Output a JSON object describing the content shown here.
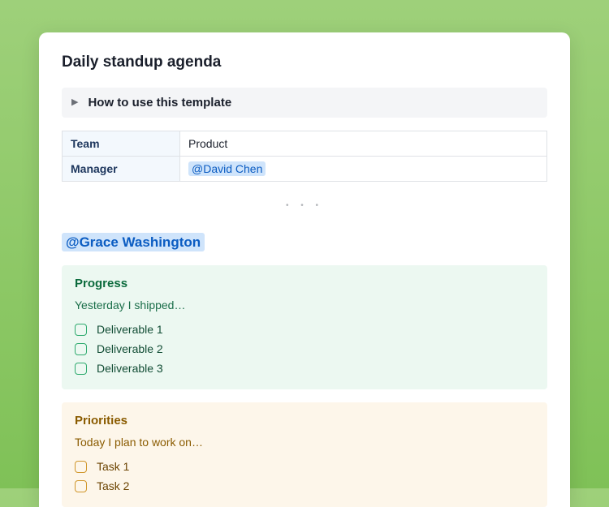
{
  "title": "Daily standup agenda",
  "collapsible": {
    "label": "How to use this template"
  },
  "meta": {
    "team_label": "Team",
    "team_value": "Product",
    "manager_label": "Manager",
    "manager_value": "@David Chen"
  },
  "dots": "• • •",
  "user_mention": "@Grace Washington",
  "progress": {
    "heading": "Progress",
    "subtitle": "Yesterday I shipped…",
    "items": [
      "Deliverable 1",
      "Deliverable 2",
      "Deliverable 3"
    ]
  },
  "priorities": {
    "heading": "Priorities",
    "subtitle": "Today I plan to work on…",
    "items": [
      "Task 1",
      "Task 2"
    ]
  }
}
